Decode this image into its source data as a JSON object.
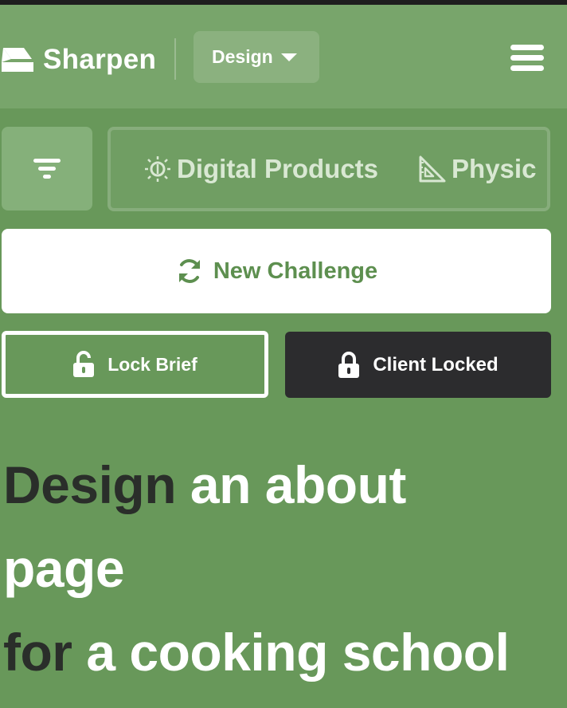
{
  "header": {
    "logo_text": "Sharpen",
    "dropdown_label": "Design"
  },
  "categories": [
    {
      "label": "Digital Products",
      "icon": "lightbulb-icon"
    },
    {
      "label": "Physic",
      "icon": "set-square-icon"
    }
  ],
  "actions": {
    "new_challenge_label": "New Challenge",
    "lock_brief_label": "Lock Brief",
    "client_locked_label": "Client Locked"
  },
  "headline": {
    "line1_verb": "Design",
    "line1_rest": "an about",
    "line2": "page",
    "line3_prep": "for",
    "line3_rest": "a cooking school"
  },
  "colors": {
    "background": "#68985a",
    "header": "#78a56b",
    "accent_text": "#5d8f4f",
    "dark": "#2c2c2e"
  }
}
